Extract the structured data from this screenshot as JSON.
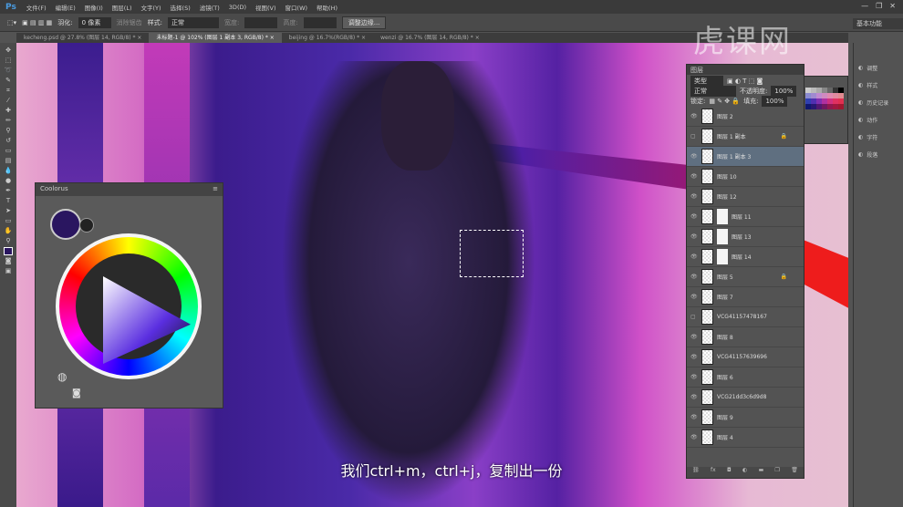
{
  "app": {
    "logo": "Ps",
    "menus": [
      "文件(F)",
      "编辑(E)",
      "图像(I)",
      "图层(L)",
      "文字(Y)",
      "选择(S)",
      "滤镜(T)",
      "3D(D)",
      "视图(V)",
      "窗口(W)",
      "帮助(H)"
    ],
    "window_buttons": [
      "—",
      "❐",
      "✕"
    ]
  },
  "options": {
    "feather_label": "羽化:",
    "feather_value": "0 像素",
    "antialias_label": "消除锯齿",
    "style_label": "样式:",
    "style_value": "正常",
    "width_label": "宽度:",
    "height_label": "高度:",
    "refine_button": "调整边缘..."
  },
  "tabs": [
    {
      "label": "kecheng.psd @ 27.8% (图层 14, RGB/8) *  ×"
    },
    {
      "label": "未标题-1 @ 102% (图层 1 副本 3, RGB/8) *  ×",
      "active": true
    },
    {
      "label": "beijing @ 16.7%(RGB/8) *  ×"
    },
    {
      "label": "wenzi @ 16.7% (图层 14, RGB/8) *  ×"
    }
  ],
  "workspace": "基本功能",
  "watermark": "虎课网",
  "coolorus": {
    "title": "Coolorus",
    "main_color": "#2a1660"
  },
  "layers_panel": {
    "title": "图层",
    "filter": "类型",
    "blend_mode": "正常",
    "opacity_label": "不透明度:",
    "opacity": "100%",
    "lock_label": "锁定:",
    "fill_label": "填充:",
    "fill": "100%",
    "layers": [
      {
        "name": "图层 2",
        "visible": true
      },
      {
        "name": "图层 1 副本",
        "visible": false,
        "locked": true
      },
      {
        "name": "图层 1 副本 3",
        "visible": true,
        "selected": true
      },
      {
        "name": "图层 10",
        "visible": true
      },
      {
        "name": "图层 12",
        "visible": true
      },
      {
        "name": "图层 11",
        "visible": true,
        "mask": true
      },
      {
        "name": "图层 13",
        "visible": true,
        "mask": true
      },
      {
        "name": "图层 14",
        "visible": true,
        "mask": true
      },
      {
        "name": "图层 5",
        "visible": true,
        "locked": true
      },
      {
        "name": "图层 7",
        "visible": true
      },
      {
        "name": "VCG41157478167",
        "visible": false
      },
      {
        "name": "图层 8",
        "visible": true
      },
      {
        "name": "VCG41157639696",
        "visible": true
      },
      {
        "name": "图层 6",
        "visible": true
      },
      {
        "name": "VCG21dd3c6d9d8",
        "visible": true
      },
      {
        "name": "图层 9",
        "visible": true
      },
      {
        "name": "图层 4",
        "visible": true
      }
    ],
    "footer_icons": [
      "link",
      "fx",
      "mask",
      "adjust",
      "folder",
      "new",
      "trash"
    ]
  },
  "dock": [
    {
      "label": "调整",
      "icon": "adjust-icon"
    },
    {
      "label": "样式",
      "icon": "style-icon"
    },
    {
      "label": "历史记录",
      "icon": "history-icon"
    },
    {
      "label": "动作",
      "icon": "play-icon"
    },
    {
      "label": "字符",
      "icon": "character-icon"
    },
    {
      "label": "段落",
      "icon": "paragraph-icon"
    }
  ],
  "subtitle": "我们ctrl+m，ctrl+j，复制出一份"
}
